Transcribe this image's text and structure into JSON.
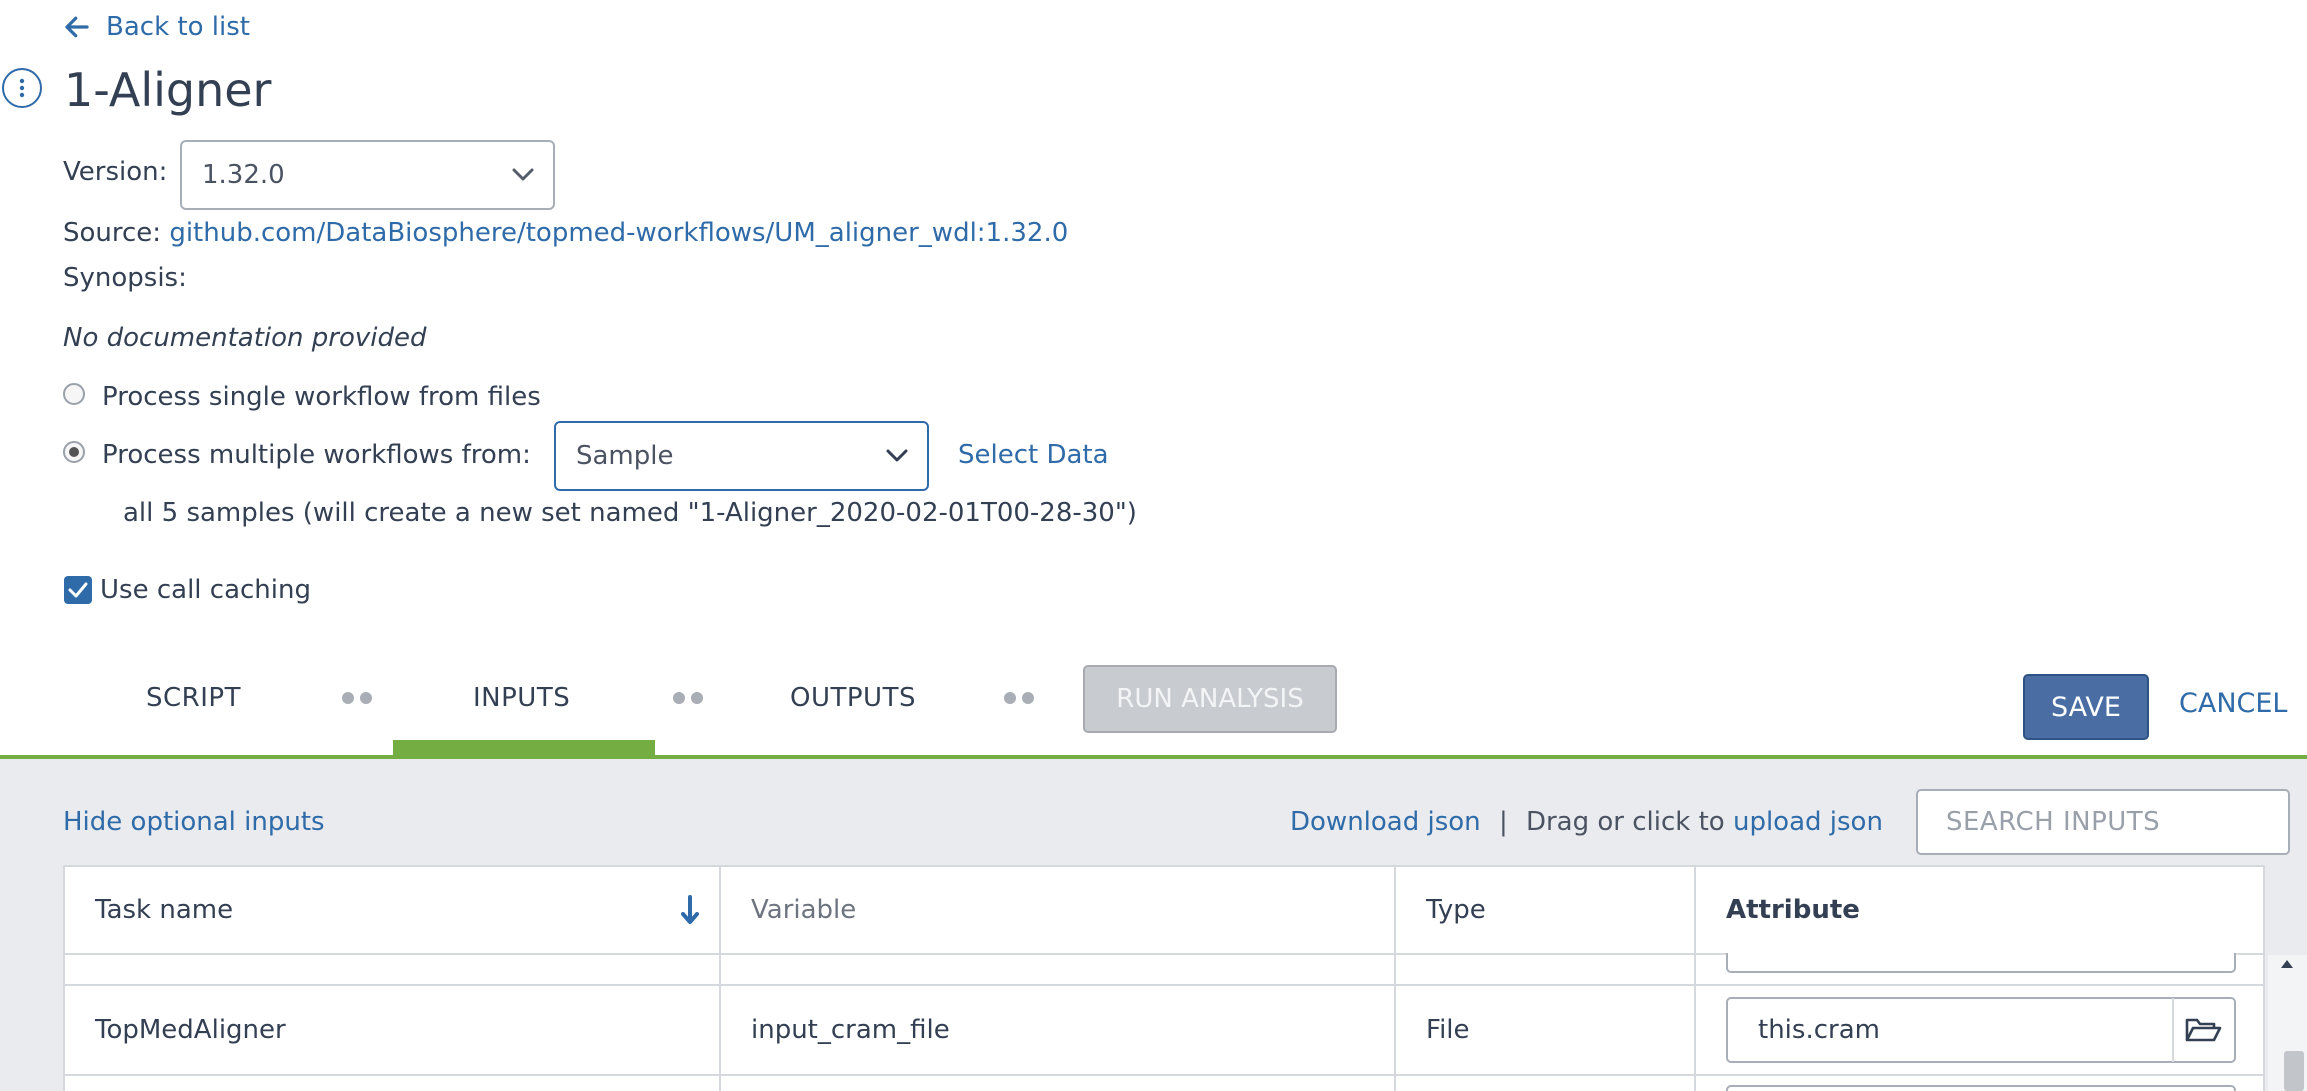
{
  "nav": {
    "back_label": "Back to list"
  },
  "workflow": {
    "title": "1-Aligner",
    "version_label": "Version:",
    "version_value": "1.32.0",
    "source_label": "Source:",
    "source_link": "github.com/DataBiosphere/topmed-workflows/UM_aligner_wdl:1.32.0",
    "synopsis_label": "Synopsis:",
    "documentation": "No documentation provided"
  },
  "process": {
    "single_label": "Process single workflow from files",
    "multiple_label": "Process multiple workflows from:",
    "entity_value": "Sample",
    "select_data_label": "Select Data",
    "selection_summary": "all 5 samples (will create a new set named \"1-Aligner_2020-02-01T00-28-30\")",
    "selected": "multiple"
  },
  "call_caching": {
    "label": "Use call caching",
    "checked": true
  },
  "tabs": [
    {
      "label": "SCRIPT",
      "active": false
    },
    {
      "label": "INPUTS",
      "active": true
    },
    {
      "label": "OUTPUTS",
      "active": false
    }
  ],
  "actions": {
    "run_label": "RUN ANALYSIS",
    "save_label": "SAVE",
    "cancel_label": "CANCEL"
  },
  "inputs_toolbar": {
    "hide_optional_label": "Hide optional inputs",
    "download_label": "Download json",
    "separator": "|",
    "drag_text": "Drag or click to",
    "upload_label": "upload json",
    "search_placeholder": "SEARCH INPUTS"
  },
  "table": {
    "columns": [
      "Task name",
      "Variable",
      "Type",
      "Attribute"
    ],
    "rows": [
      {
        "task": "TopMedAligner",
        "variable": "input_cram_file",
        "type": "File",
        "attribute": "this.cram"
      }
    ]
  },
  "colors": {
    "accent": "#2f6ba8",
    "tab_active": "#74ae43",
    "save_button": "#4a6ea3",
    "panel_bg": "#e9ebee"
  }
}
